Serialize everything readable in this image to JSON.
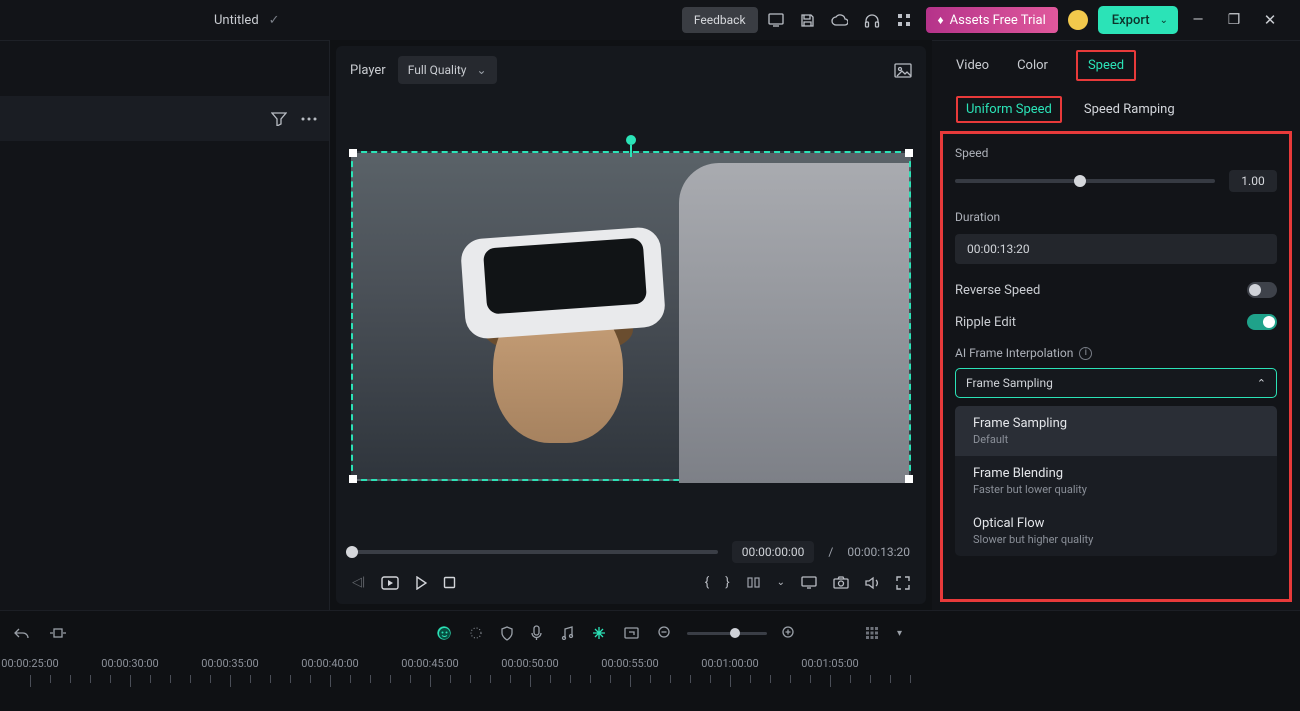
{
  "titlebar": {
    "title": "Untitled",
    "feedback": "Feedback",
    "assets_trial": "Assets Free Trial",
    "export": "Export"
  },
  "player": {
    "label": "Player",
    "quality": "Full Quality",
    "time_current": "00:00:00:00",
    "time_sep": "/",
    "time_total": "00:00:13:20"
  },
  "inspector": {
    "tabs": {
      "video": "Video",
      "color": "Color",
      "speed": "Speed"
    },
    "subtabs": {
      "uniform": "Uniform Speed",
      "ramping": "Speed Ramping"
    },
    "speed_label": "Speed",
    "speed_value": "1.00",
    "duration_label": "Duration",
    "duration_value": "00:00:13:20",
    "reverse_label": "Reverse Speed",
    "ripple_label": "Ripple Edit",
    "ai_label": "AI Frame Interpolation",
    "dd_selected": "Frame Sampling",
    "dd": [
      {
        "t": "Frame Sampling",
        "s": "Default"
      },
      {
        "t": "Frame Blending",
        "s": "Faster but lower quality"
      },
      {
        "t": "Optical Flow",
        "s": "Slower but higher quality"
      }
    ]
  },
  "ruler": {
    "labels": [
      "00:00:25:00",
      "00:00:30:00",
      "00:00:35:00",
      "00:00:40:00",
      "00:00:45:00",
      "00:00:50:00",
      "00:00:55:00",
      "00:01:00:00",
      "00:01:05:00"
    ]
  }
}
